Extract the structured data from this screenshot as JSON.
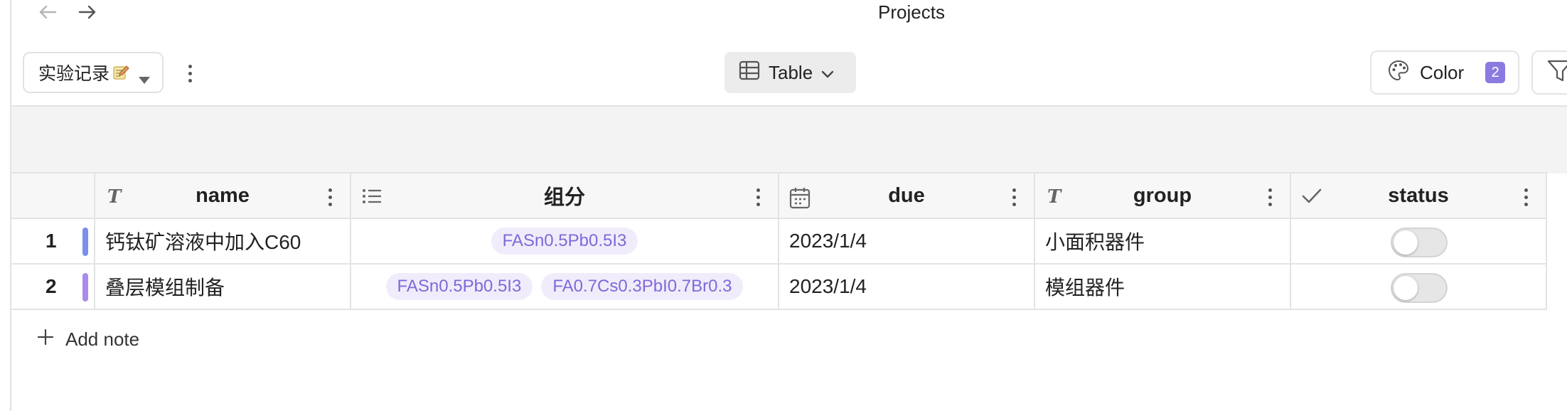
{
  "window": {
    "title": "Projects"
  },
  "toolbar": {
    "view_name": "实验记录",
    "view_emoji": "memo-icon",
    "table_label": "Table",
    "color_label": "Color",
    "color_count": "2"
  },
  "table": {
    "columns": [
      {
        "key": "name",
        "label": "name",
        "icon": "text-type-icon"
      },
      {
        "key": "composition",
        "label": "组分",
        "icon": "list-icon"
      },
      {
        "key": "due",
        "label": "due",
        "icon": "calendar-icon"
      },
      {
        "key": "group",
        "label": "group",
        "icon": "text-type-icon"
      },
      {
        "key": "status",
        "label": "status",
        "icon": "checkmark-icon"
      }
    ],
    "rows": [
      {
        "index": "1",
        "row_color": "#7b8ff0",
        "name": "钙钛矿溶液中加入C60",
        "composition": [
          "FASn0.5Pb0.5I3"
        ],
        "due": "2023/1/4",
        "group": "小面积器件",
        "status": false
      },
      {
        "index": "2",
        "row_color": "#a98bf0",
        "name": "叠层模组制备",
        "composition": [
          "FASn0.5Pb0.5I3",
          "FA0.7Cs0.3PbI0.7Br0.3"
        ],
        "due": "2023/1/4",
        "group": "模组器件",
        "status": false
      }
    ]
  },
  "footer": {
    "add_note_label": "Add note"
  },
  "colors": {
    "accent": "#8b7be0",
    "tag_bg": "#f1ecfb",
    "tag_text": "#8068d8"
  }
}
